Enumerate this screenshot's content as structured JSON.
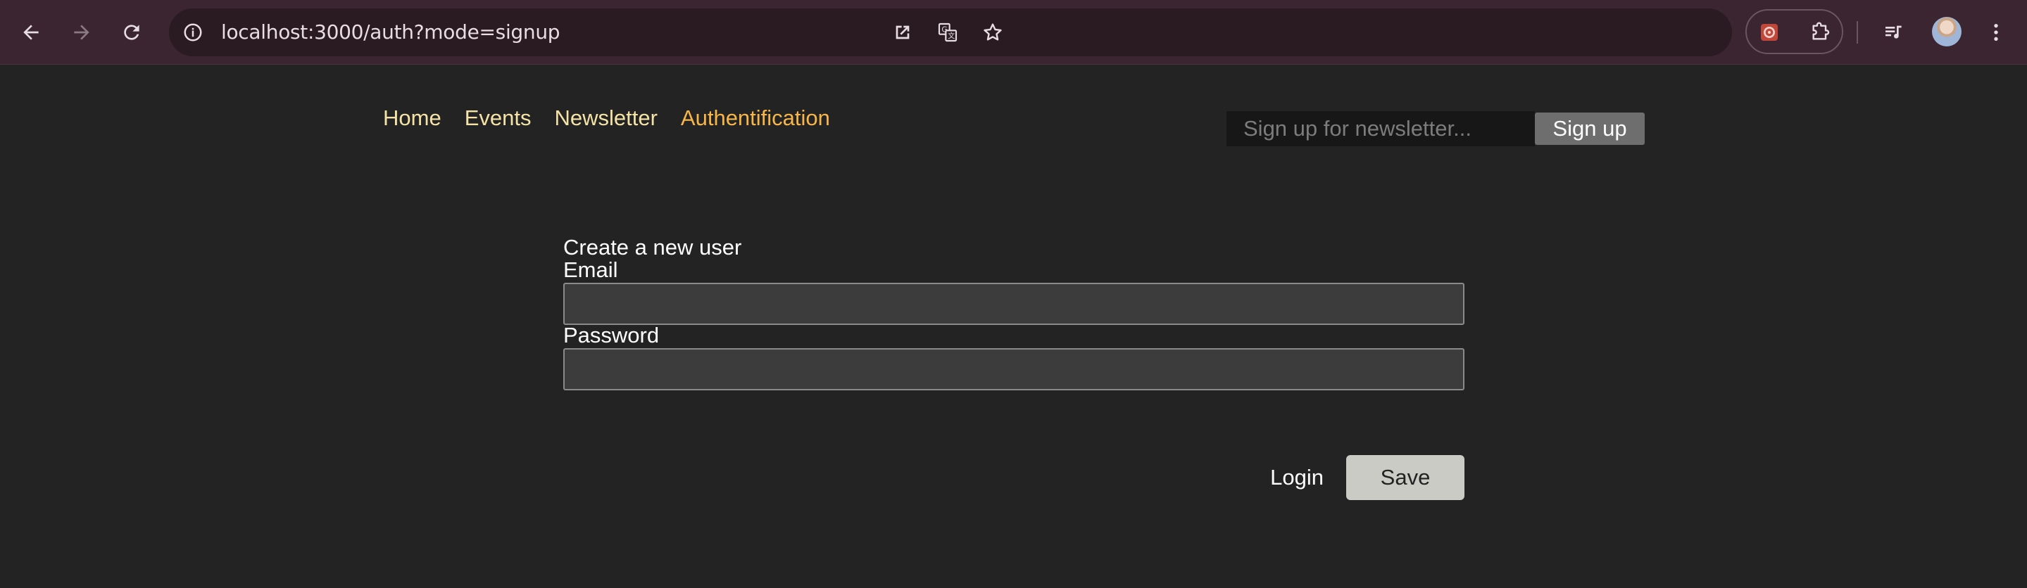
{
  "browser": {
    "url": "localhost:3000/auth?mode=signup",
    "icons": {
      "back": "arrow-left-icon",
      "forward": "arrow-right-icon",
      "reload": "reload-icon",
      "site_info": "info-icon",
      "open_in_app": "open-external-icon",
      "translate": "translate-icon",
      "bookmark": "star-icon",
      "extension_1": "extension-logo-icon",
      "extensions": "puzzle-icon",
      "media": "media-queue-icon",
      "menu": "kebab-menu-icon"
    }
  },
  "nav": {
    "items": [
      {
        "label": "Home",
        "active": false
      },
      {
        "label": "Events",
        "active": false
      },
      {
        "label": "Newsletter",
        "active": false
      },
      {
        "label": "Authentification",
        "active": true
      }
    ]
  },
  "newsletter": {
    "placeholder": "Sign up for newsletter...",
    "button_label": "Sign up"
  },
  "auth_form": {
    "title": "Create a new user",
    "email_label": "Email",
    "email_value": "",
    "password_label": "Password",
    "password_value": "",
    "login_link": "Login",
    "save_label": "Save"
  },
  "colors": {
    "page_bg": "#232323",
    "nav_link": "#f4e2a6",
    "nav_active": "#f6b64a",
    "chrome_bg": "#3a2530"
  }
}
